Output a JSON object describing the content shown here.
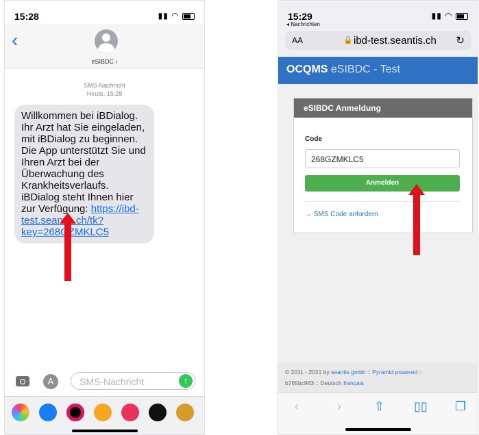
{
  "left_phone": {
    "status_time": "15:28",
    "contact_name": "eSIBDC",
    "meta_line1": "SMS-Nachricht",
    "meta_line2": "Heute, 15:28",
    "message_text": "Willkommen bei iBDialog. Ihr Arzt hat Sie eingeladen, mit iBDialog zu beginnen. Die App unterstützt Sie und Ihren Arzt bei der Überwachung des Krankheitsverlaufs. iBDialog steht Ihnen hier zur Verfügung: ",
    "message_link": "https://ibd-test.seantis.ch/tk?key=268GZMKLC5",
    "input_placeholder": "SMS-Nachricht",
    "tray_apps": [
      "photos-icon",
      "app-store-icon",
      "activity-icon",
      "memoji-icon",
      "search-web-icon",
      "heart-icon",
      "avatar-icon"
    ]
  },
  "right_phone": {
    "status_time": "15:29",
    "back_label": "Nachrichten",
    "aa_label": "AA",
    "url": "ibd-test.seantis.ch",
    "site_brand_bold": "OCQMS",
    "site_brand_rest": " eSIBDC - Test",
    "card_title": "eSIBDC Anmeldung",
    "code_label": "Code",
    "code_value": "268GZMKLC5",
    "login_button": "Anmelden",
    "sms_code_link": "→ SMS Code anfordern",
    "footer_line1_prefix": "© 2011 - 2021 by ",
    "footer_company": "seantis gmbh",
    "footer_sep": " :: ",
    "footer_powered": "Pyramid powered",
    "footer_line2_prefix": "b765bc963 :: Deutsch ",
    "footer_lang": "français"
  },
  "colors": {
    "accent": "#1a7cf5",
    "site_blue": "#2f72c4",
    "button_green": "#4cae4c",
    "arrow_red": "#e0111b"
  }
}
